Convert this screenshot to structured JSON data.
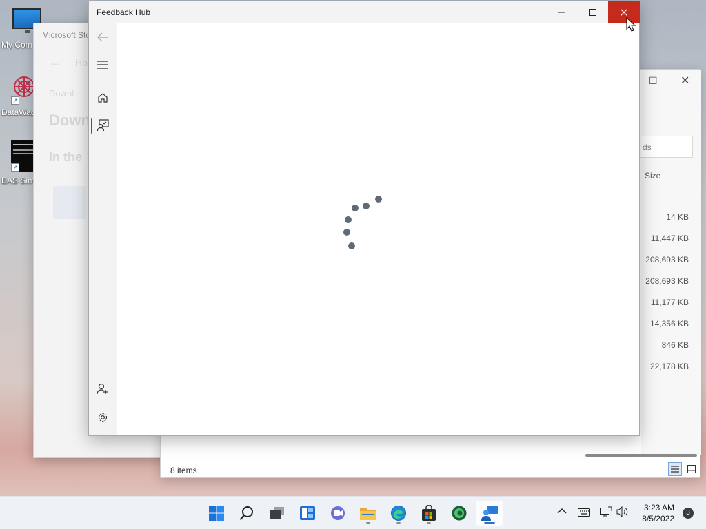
{
  "desktop": {
    "icons": [
      {
        "label": "My Com",
        "icon": "monitor-icon"
      },
      {
        "label": "DataWag",
        "icon": "datawag-icon"
      },
      {
        "label": "EAS Simu",
        "icon": "terminal-icon"
      }
    ]
  },
  "store_window": {
    "title": "Microsoft Sto",
    "nav_home": "Ho",
    "breadcrumb": "Downl",
    "heading": "Down",
    "subheading": "In the"
  },
  "explorer_window": {
    "search_placeholder": "ds",
    "size_header": "Size",
    "sizes": [
      "14 KB",
      "11,447 KB",
      "208,693 KB",
      "208,693 KB",
      "11,177 KB",
      "14,356 KB",
      "846 KB",
      "22,178 KB"
    ],
    "status": "8 items"
  },
  "feedback_hub": {
    "title": "Feedback Hub",
    "nav": [
      "back-arrow-icon",
      "hamburger-menu-icon",
      "home-icon",
      "feedback-icon",
      "add-user-icon",
      "gear-icon"
    ],
    "loading": true
  },
  "taskbar": {
    "apps": [
      "start-icon",
      "search-icon",
      "task-view-icon",
      "widgets-icon",
      "teams-chat-icon",
      "file-explorer-icon",
      "edge-icon",
      "store-icon",
      "edge-beta-icon",
      "feedback-hub-icon"
    ],
    "time": "3:23 AM",
    "date": "8/5/2022",
    "notification_count": "3"
  },
  "colors": {
    "close_red": "#c42b1c",
    "spinner": "#5f6a76",
    "accent": "#2a6fc9"
  }
}
